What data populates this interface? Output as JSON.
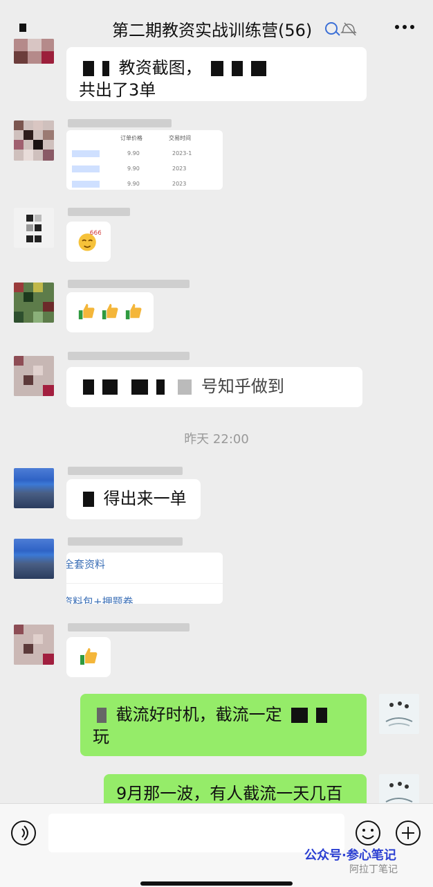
{
  "header": {
    "title": "第二期教资实战训练营(56)",
    "back_icon": "back-icon",
    "more_icon": "more-icon"
  },
  "messages": [
    {
      "kind": "text",
      "text_top": "教资截图，",
      "text_line2": "共出了3单"
    },
    {
      "kind": "table-image",
      "headers": [
        "订单价格",
        "交易时间"
      ],
      "rows": [
        [
          "9.90",
          "2023-1"
        ],
        [
          "9.90",
          "2023"
        ],
        [
          "9.90",
          "2023"
        ]
      ]
    },
    {
      "kind": "emoji",
      "emoji_name": "666-face-emoji",
      "text": "666"
    },
    {
      "kind": "emoji",
      "emoji_name": "thumbs-up-icons",
      "count": 3
    },
    {
      "kind": "text",
      "text": "号知乎做到"
    },
    {
      "kind": "timestamp",
      "text": "昨天 22:00"
    },
    {
      "kind": "text",
      "text": "得出来一单"
    },
    {
      "kind": "link-card",
      "line1": "全套资料",
      "line2": "资料包+押题卷"
    },
    {
      "kind": "emoji",
      "emoji_name": "thumbs-up-icon",
      "count": 1
    },
    {
      "kind": "text",
      "side": "right",
      "text_line1": "截流好时机，截流一定",
      "text_line2": "玩"
    },
    {
      "kind": "text",
      "side": "right",
      "text": "9月那一波，有人截流一天几百"
    }
  ],
  "composer": {
    "voice_icon": "voice-icon",
    "emoji_icon": "emoji-icon",
    "add_icon": "add-icon"
  },
  "watermark": {
    "line1": "公众号·参心笔记",
    "line2": "阿拉丁笔记"
  }
}
